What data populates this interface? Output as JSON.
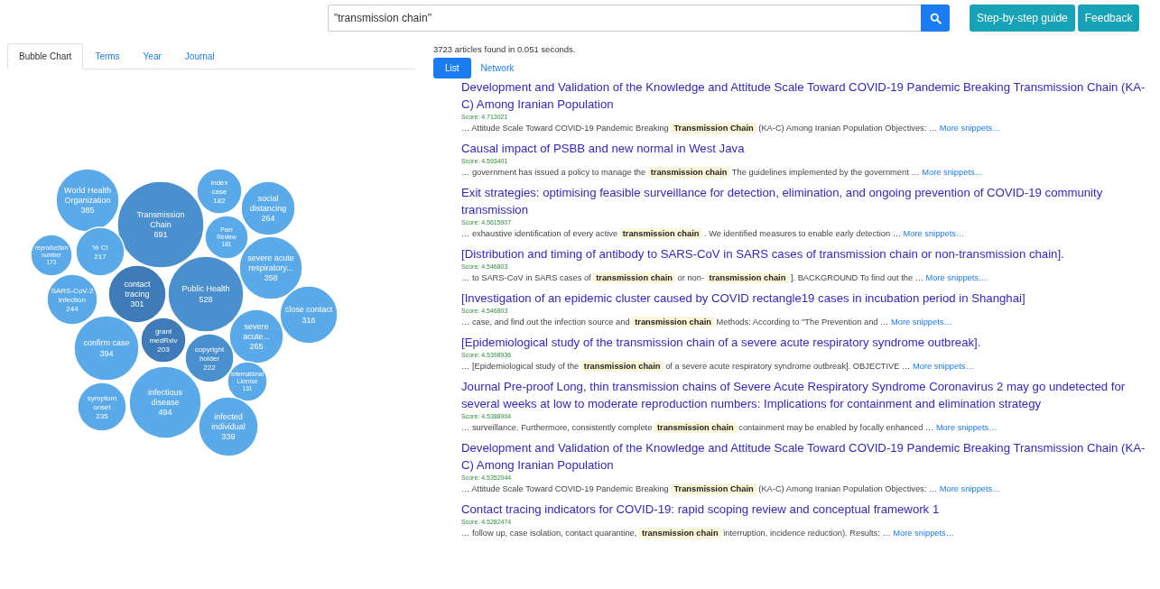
{
  "search": {
    "value": "\"transmission chain\""
  },
  "header_buttons": [
    "Step-by-step guide",
    "Feedback"
  ],
  "left_tabs": [
    {
      "label": "Bubble Chart",
      "selected": true
    },
    {
      "label": "Terms",
      "selected": false
    },
    {
      "label": "Year",
      "selected": false
    },
    {
      "label": "Journal",
      "selected": false
    }
  ],
  "bubbles": [
    {
      "lines": [
        "World Health",
        "Organization"
      ],
      "count": "385",
      "color": "#5aaaea"
    },
    {
      "lines": [
        "Transmission",
        "Chain"
      ],
      "count": "691",
      "color": "#4a8fce"
    },
    {
      "lines": [
        "index",
        "case"
      ],
      "count": "182",
      "color": "#5aaaea"
    },
    {
      "lines": [
        "social",
        "distancing"
      ],
      "count": "264",
      "color": "#5aaaea"
    },
    {
      "lines": [
        "Peer",
        "Review"
      ],
      "count": "181",
      "color": "#5aaaea"
    },
    {
      "lines": [
        "reproduction",
        "number"
      ],
      "count": "173",
      "color": "#5aaaea"
    },
    {
      "lines": [
        "% CI"
      ],
      "count": "217",
      "color": "#5aaaea"
    },
    {
      "lines": [
        "severe acute",
        "respiratory..."
      ],
      "count": "358",
      "color": "#5aaaea"
    },
    {
      "lines": [
        "SARS-CoV-2",
        "infection"
      ],
      "count": "244",
      "color": "#5aaaea"
    },
    {
      "lines": [
        "contact",
        "tracing"
      ],
      "count": "301",
      "color": "#3e7bb8"
    },
    {
      "lines": [
        "Public Health"
      ],
      "count": "528",
      "color": "#4a8fce"
    },
    {
      "lines": [
        "close contact"
      ],
      "count": "316",
      "color": "#5aaaea"
    },
    {
      "lines": [
        "severe",
        "acute..."
      ],
      "count": "265",
      "color": "#5aaaea"
    },
    {
      "lines": [
        "confirm case"
      ],
      "count": "394",
      "color": "#5aaaea"
    },
    {
      "lines": [
        "grant",
        "medRxiv"
      ],
      "count": "203",
      "color": "#3e7bb8"
    },
    {
      "lines": [
        "copyright",
        "holder"
      ],
      "count": "222",
      "color": "#4a8fce"
    },
    {
      "lines": [
        "International",
        "License"
      ],
      "count": "131",
      "color": "#5aaaea"
    },
    {
      "lines": [
        "symptom",
        "onset"
      ],
      "count": "235",
      "color": "#5aaaea"
    },
    {
      "lines": [
        "infectious",
        "disease"
      ],
      "count": "494",
      "color": "#5aaaea"
    },
    {
      "lines": [
        "infected",
        "individual"
      ],
      "count": "339",
      "color": "#5aaaea"
    }
  ],
  "result_count": "3723 articles found in 0.051 seconds.",
  "view_tabs": [
    {
      "label": "List",
      "selected": true
    },
    {
      "label": "Network",
      "selected": false
    }
  ],
  "results": [
    {
      "title": "Development and Validation of the Knowledge and Attitude Scale Toward COVID-19 Pandemic Breaking Transmission Chain (KA-C) Among Iranian Population",
      "score": "Score: 4.713021",
      "snippet": "… Attitude Scale Toward COVID-19 Pandemic Breaking **Transmission Chain** (KA-C) Among Iranian Population Objectives: …",
      "more": "More snippets…"
    },
    {
      "title": "Causal impact of PSBB and new normal in West Java",
      "score": "Score: 4.593401",
      "snippet": "… government has issued a policy to manage the **transmission chain** The guidelines implemented by the government …",
      "more": "More snippets…"
    },
    {
      "title": "Exit strategies: optimising feasible surveillance for detection, elimination, and ongoing prevention of COVID-19 community transmission",
      "score": "Score: 4.5615907",
      "snippet": "… exhaustive identification of every active **transmission chain** . We identified measures to enable early detection …",
      "more": "More snippets…"
    },
    {
      "title": "[Distribution and timing of antibody to SARS-CoV in SARS cases of transmission chain or non-transmission chain].",
      "score": "Score: 4.546803",
      "snippet": "… to SARS-CoV in SARS cases of **transmission chain** or non- **transmission chain** ]. BACKGROUND To find out the …",
      "more": "More snippets…"
    },
    {
      "title": "[Investigation of an epidemic cluster caused by COVID rectangle19 cases in incubation period in Shanghai]",
      "score": "Score: 4.546803",
      "snippet": "… case, and find out the infection source and **transmission chain** Methods: According to \"The Prevention and …",
      "more": "More snippets…"
    },
    {
      "title": "[Epidemiological study of the transmission chain of a severe acute respiratory syndrome outbreak].",
      "score": "Score: 4.5398936",
      "snippet": "… [Epidemiological study of the **transmission chain** of a severe acute respiratory syndrome outbreak]. OBJECTIVE …",
      "more": "More snippets…"
    },
    {
      "title": "Journal Pre-proof Long, thin transmission chains of Severe Acute Respiratory Syndrome Coronavirus 2 may go undetected for several weeks at low to moderate reproduction numbers: Implications for containment and elimination strategy",
      "score": "Score: 4.5388904",
      "snippet": "… surveillance. Furthermore, consistently complete **transmission chain** containment may be enabled by focally enhanced …",
      "more": "More snippets…"
    },
    {
      "title": "Development and Validation of the Knowledge and Attitude Scale Toward COVID-19 Pandemic Breaking Transmission Chain (KA-C) Among Iranian Population",
      "score": "Score: 4.5352044",
      "snippet": "… Attitude Scale Toward COVID-19 Pandemic Breaking **Transmission Chain** (KA-C) Among Iranian Population Objectives: …",
      "more": "More snippets…"
    },
    {
      "title": "Contact tracing indicators for COVID-19: rapid scoping review and conceptual framework 1",
      "score": "Score: 4.5282474",
      "snippet": "… follow up, case isolation, contact quarantine, **transmission chain** interruption, incidence reduction). Results: …",
      "more": "More snippets…"
    }
  ]
}
